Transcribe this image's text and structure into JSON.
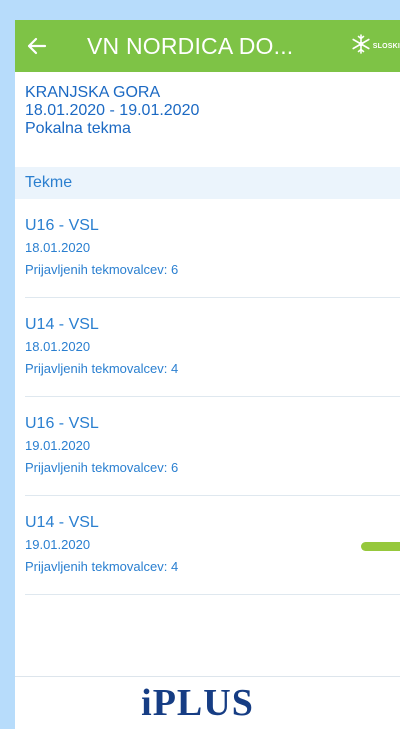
{
  "appbar": {
    "title": "VN NORDICA DO...",
    "logo_text": "SLOSKI",
    "back_icon": "arrow-left-icon",
    "logo_icon": "snowflake-icon",
    "color": "#7ec346"
  },
  "event": {
    "location": "KRANJSKA GORA",
    "dates": "18.01.2020 - 19.01.2020",
    "type": "Pokalna tekma"
  },
  "section": {
    "title": "Tekme"
  },
  "races": [
    {
      "title": "U16 - VSL",
      "date": "18.01.2020",
      "registered": "Prijavljenih tekmovalcev: 6"
    },
    {
      "title": "U14 - VSL",
      "date": "18.01.2020",
      "registered": "Prijavljenih tekmovalcev: 4"
    },
    {
      "title": "U16 - VSL",
      "date": "19.01.2020",
      "registered": "Prijavljenih tekmovalcev: 6"
    },
    {
      "title": "U14 - VSL",
      "date": "19.01.2020",
      "registered": "Prijavljenih tekmovalcev: 4"
    }
  ],
  "footer": {
    "brand": "iPLUS"
  },
  "colors": {
    "accent_green": "#7ec346",
    "link_blue": "#2a7fd0",
    "brand_navy": "#163d84",
    "section_bg": "#ebf4fc"
  }
}
